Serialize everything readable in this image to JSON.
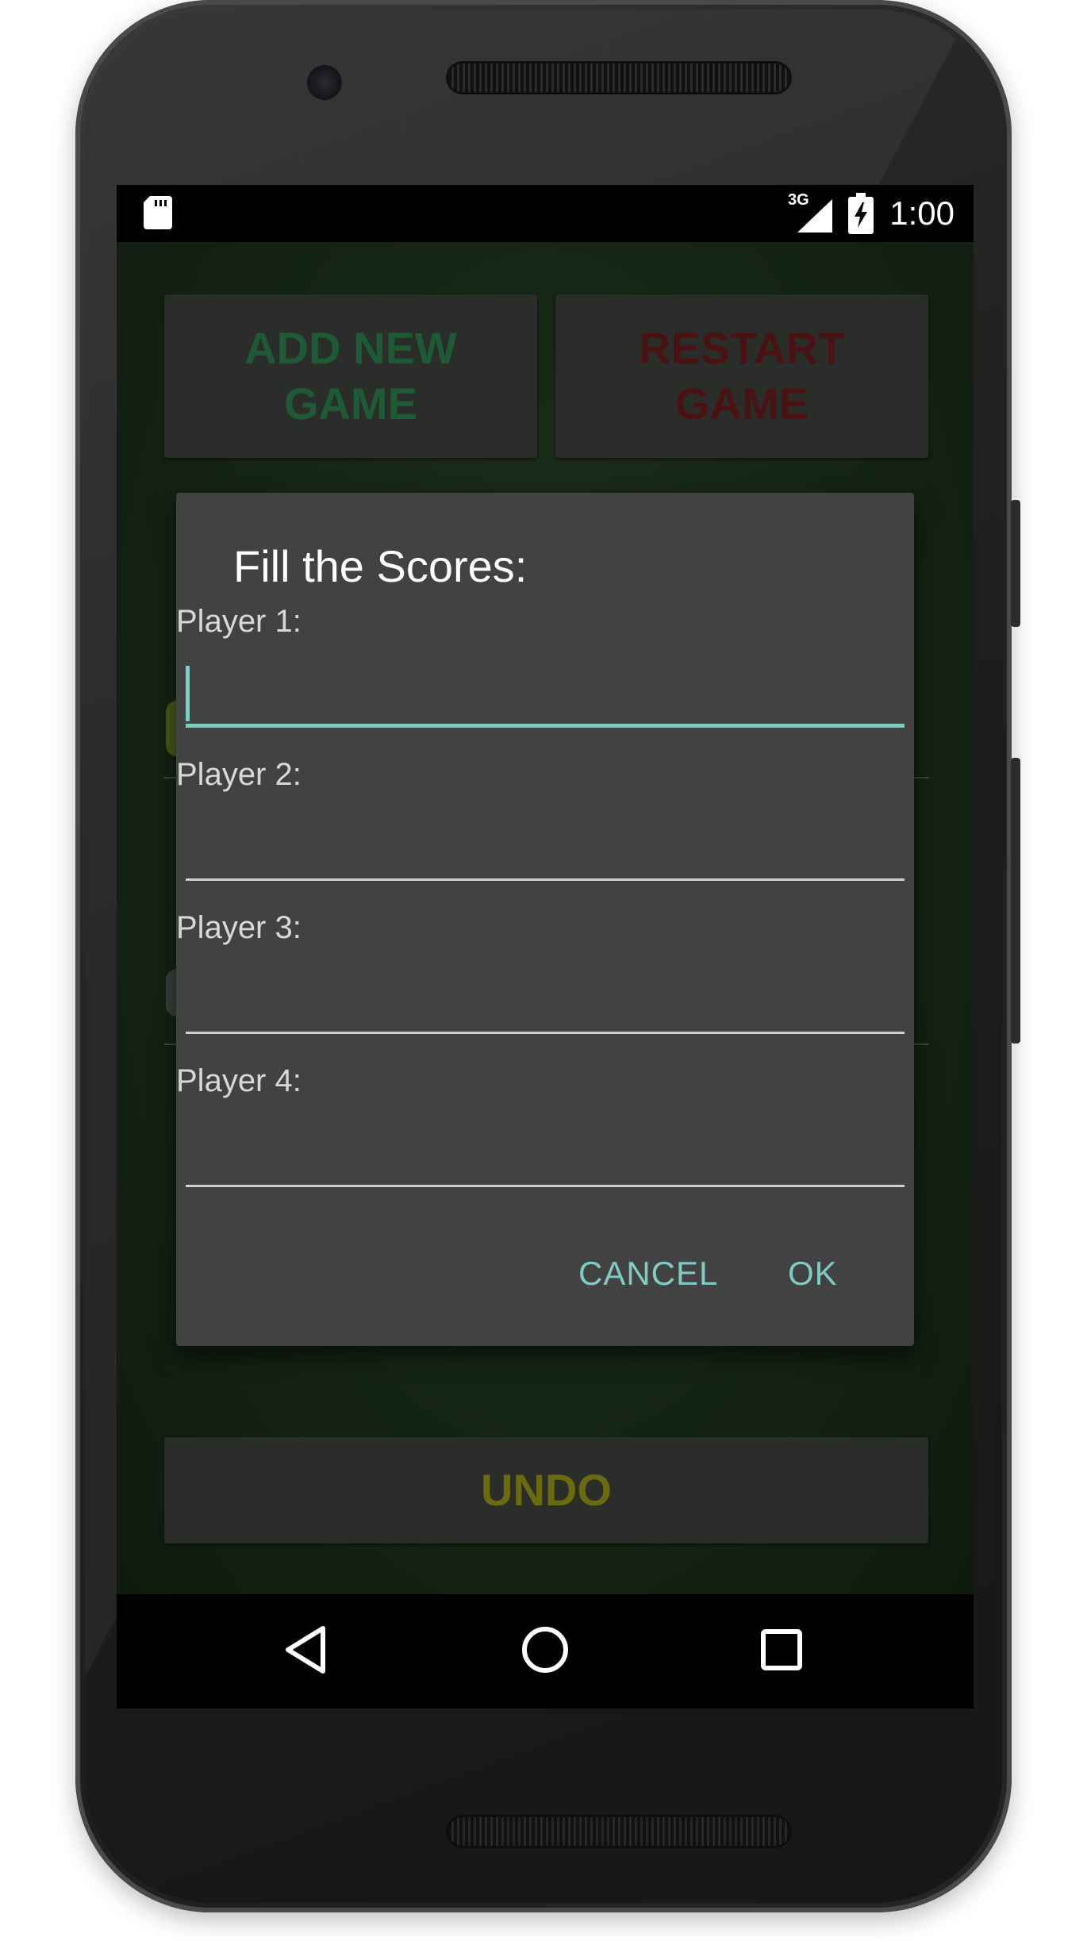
{
  "status_bar": {
    "time": "1:00",
    "network_label": "3G",
    "icons": [
      "sd-card-icon",
      "signal-3g-icon",
      "battery-charging-icon"
    ]
  },
  "app": {
    "add_new_game_label": "ADD NEW\nGAME",
    "restart_game_label": "RESTART\nGAME",
    "undo_label": "UNDO",
    "colors": {
      "add_new_game_text": "#1f5a36",
      "restart_game_text": "#4a1212",
      "undo_text": "#6b6a10",
      "background": "#152215",
      "button_bg": "#2b2d2b"
    }
  },
  "dialog": {
    "title": "Fill the Scores:",
    "fields": [
      {
        "label": "Player 1:",
        "value": "",
        "focused": true
      },
      {
        "label": "Player 2:",
        "value": "",
        "focused": false
      },
      {
        "label": "Player 3:",
        "value": "",
        "focused": false
      },
      {
        "label": "Player 4:",
        "value": "",
        "focused": false
      }
    ],
    "cancel_label": "CANCEL",
    "ok_label": "OK",
    "colors": {
      "background": "#424242",
      "accent": "#80cbc4"
    }
  },
  "nav_bar": {
    "icons": [
      "back-icon",
      "home-icon",
      "recents-icon"
    ]
  }
}
